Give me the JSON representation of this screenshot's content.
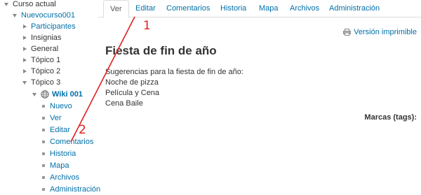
{
  "sidebar": {
    "items": [
      {
        "label": "Curso actual",
        "expanded": true,
        "link": false
      },
      {
        "label": "Nuevocurso001",
        "expanded": true,
        "link": true
      },
      {
        "label": "Participantes",
        "expanded": false,
        "link": true
      },
      {
        "label": "Insignias",
        "expanded": false,
        "link": false
      },
      {
        "label": "General",
        "expanded": false,
        "link": false
      },
      {
        "label": "Tópico 1",
        "expanded": false,
        "link": false
      },
      {
        "label": "Tópico 2",
        "expanded": false,
        "link": false
      },
      {
        "label": "Tópico 3",
        "expanded": true,
        "link": false
      },
      {
        "label": "Wiki 001",
        "expanded": true,
        "link": true,
        "icon": "wiki-icon"
      },
      {
        "label": "Nuevo"
      },
      {
        "label": "Ver"
      },
      {
        "label": "Editar"
      },
      {
        "label": "Comentarios"
      },
      {
        "label": "Historia"
      },
      {
        "label": "Mapa"
      },
      {
        "label": "Archivos"
      },
      {
        "label": "Administración"
      }
    ]
  },
  "tabs": [
    {
      "label": "Ver",
      "active": true
    },
    {
      "label": "Editar",
      "active": false
    },
    {
      "label": "Comentarios",
      "active": false
    },
    {
      "label": "Historia",
      "active": false
    },
    {
      "label": "Mapa",
      "active": false
    },
    {
      "label": "Archivos",
      "active": false
    },
    {
      "label": "Administración",
      "active": false
    }
  ],
  "main": {
    "printable_label": "Versión imprimible",
    "printable_icon": "printer-icon",
    "title": "Fiesta de fin de año",
    "lines": [
      "Sugerencias para la fiesta de fin de año:",
      "Noche de pizza",
      "Película y Cena",
      "Cena Baile"
    ],
    "tags_label": "Marcas (tags):"
  },
  "annotations": {
    "marker_1": "1",
    "marker_2": "2",
    "color": "#e02020"
  },
  "colors": {
    "link": "#0070a8",
    "text": "#333333",
    "tab_border": "#dddddd"
  }
}
